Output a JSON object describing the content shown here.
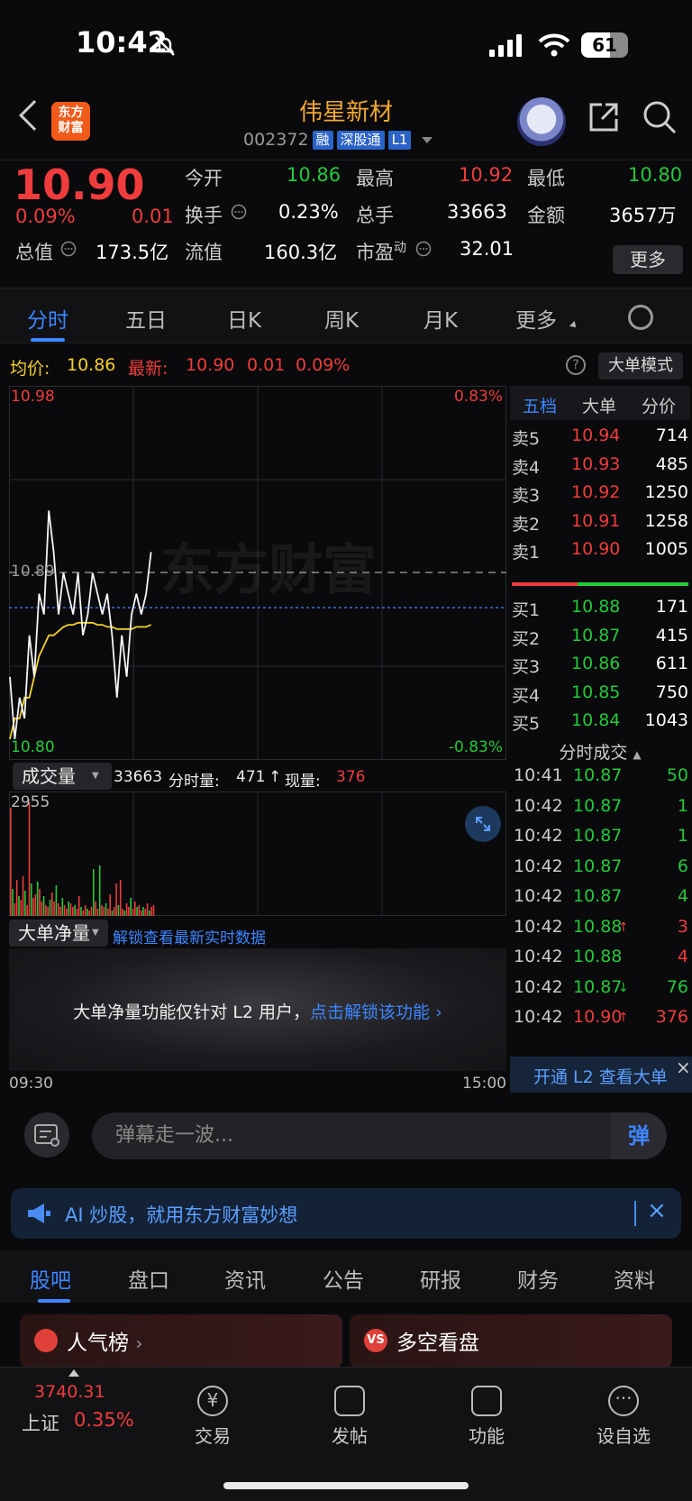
{
  "status_bar": {
    "time": "10:42",
    "battery": "61"
  },
  "header": {
    "logo_line1": "东方",
    "logo_line2": "财富",
    "stock_name": "伟星新材",
    "stock_code": "002372",
    "tags": [
      "融",
      "深股通",
      "L1"
    ]
  },
  "quote": {
    "price": "10.90",
    "change_pct": "0.09%",
    "change": "0.01",
    "open_label": "今开",
    "open": "10.86",
    "high_label": "最高",
    "high": "10.92",
    "low_label": "最低",
    "low": "10.80",
    "turnover_label": "换手",
    "turnover": "0.23%",
    "volume_label": "总手",
    "volume": "33663",
    "amount_label": "金额",
    "amount": "3657万",
    "mktcap_label": "总值",
    "mktcap": "173.5亿",
    "float_label": "流值",
    "float": "160.3亿",
    "pe_label": "市盈",
    "pe_sup": "动",
    "pe": "32.01",
    "more_button": "更多"
  },
  "tabs": [
    "分时",
    "五日",
    "日K",
    "周K",
    "月K",
    "更多"
  ],
  "infoline": {
    "avg_label": "均价:",
    "avg": "10.86",
    "latest_label": "最新:",
    "latest": "10.90",
    "latest_change": "0.01",
    "latest_pct": "0.09%",
    "help": "?",
    "mode_button": "大单模式"
  },
  "chart_labels": {
    "top_price": "10.98",
    "top_pct": "0.83%",
    "mid_price": "10.89",
    "bottom_price": "10.80",
    "bottom_pct": "-0.83%",
    "watermark": "东方财富"
  },
  "chart_data": {
    "type": "line",
    "ylim": [
      10.8,
      10.98
    ],
    "reference": 10.89,
    "series": [
      {
        "values": [
          10.84,
          10.81,
          10.83,
          10.82,
          10.86,
          10.84,
          10.88,
          10.87,
          10.92,
          10.9,
          10.87,
          10.89,
          10.88,
          10.87,
          10.89,
          10.86,
          10.87,
          10.89,
          10.88,
          10.87,
          10.88,
          10.86,
          10.83,
          10.86,
          10.84,
          10.87,
          10.88,
          10.87,
          10.88,
          10.9
        ]
      },
      {
        "values": [
          10.81,
          10.82,
          10.82,
          10.83,
          10.83,
          10.84,
          10.85,
          10.855,
          10.86,
          10.86,
          10.862,
          10.864,
          10.865,
          10.865,
          10.866,
          10.866,
          10.866,
          10.866,
          10.865,
          10.865,
          10.864,
          10.864,
          10.863,
          10.863,
          10.863,
          10.863,
          10.864,
          10.864,
          10.864,
          10.865
        ]
      }
    ]
  },
  "orderbook": {
    "tabs": [
      "五档",
      "大单",
      "分价"
    ],
    "asks": [
      {
        "label": "卖5",
        "price": "10.94",
        "vol": "714"
      },
      {
        "label": "卖4",
        "price": "10.93",
        "vol": "485"
      },
      {
        "label": "卖3",
        "price": "10.92",
        "vol": "1250"
      },
      {
        "label": "卖2",
        "price": "10.91",
        "vol": "1258"
      },
      {
        "label": "卖1",
        "price": "10.90",
        "vol": "1005"
      }
    ],
    "bids": [
      {
        "label": "买1",
        "price": "10.88",
        "vol": "171"
      },
      {
        "label": "买2",
        "price": "10.87",
        "vol": "415"
      },
      {
        "label": "买3",
        "price": "10.86",
        "vol": "611"
      },
      {
        "label": "买4",
        "price": "10.85",
        "vol": "750"
      },
      {
        "label": "买5",
        "price": "10.84",
        "vol": "1043"
      }
    ],
    "ticks_title": "分时成交",
    "ticks": [
      {
        "time": "10:41",
        "price": "10.87",
        "vol": "50",
        "dir": "",
        "pc": "green",
        "vc": "green"
      },
      {
        "time": "10:42",
        "price": "10.87",
        "vol": "1",
        "dir": "",
        "pc": "green",
        "vc": "green"
      },
      {
        "time": "10:42",
        "price": "10.87",
        "vol": "1",
        "dir": "",
        "pc": "green",
        "vc": "green"
      },
      {
        "time": "10:42",
        "price": "10.87",
        "vol": "6",
        "dir": "",
        "pc": "green",
        "vc": "green"
      },
      {
        "time": "10:42",
        "price": "10.87",
        "vol": "4",
        "dir": "",
        "pc": "green",
        "vc": "green"
      },
      {
        "time": "10:42",
        "price": "10.88",
        "vol": "3",
        "dir": "↑",
        "pc": "green",
        "vc": "red"
      },
      {
        "time": "10:42",
        "price": "10.88",
        "vol": "4",
        "dir": "",
        "pc": "green",
        "vc": "red"
      },
      {
        "time": "10:42",
        "price": "10.87",
        "vol": "76",
        "dir": "↓",
        "pc": "green",
        "vc": "green"
      },
      {
        "time": "10:42",
        "price": "10.90",
        "vol": "376",
        "dir": "↑",
        "pc": "red",
        "vc": "red"
      }
    ]
  },
  "volume": {
    "selector": "成交量",
    "total": "33663",
    "period_label": "分时量:",
    "period": "471",
    "arrow": "↑",
    "now_label": "现量:",
    "now": "376",
    "max": "2955"
  },
  "bigorder": {
    "selector": "大单净量",
    "unlock_link": "解锁查看最新实时数据",
    "panel_text": "大单净量功能仅针对 L2 用户，",
    "panel_link": "点击解锁该功能",
    "time_start": "09:30",
    "time_end": "15:00"
  },
  "l2_bar": {
    "text": "开通 L2 查看大单"
  },
  "danmu": {
    "placeholder": "弹幕走一波...",
    "send": "弹"
  },
  "ai_bar": {
    "text": "AI 炒股，就用东方财富妙想"
  },
  "bottom_tabs": [
    "股吧",
    "盘口",
    "资讯",
    "公告",
    "研报",
    "财务",
    "资料"
  ],
  "cards": [
    {
      "icon": "",
      "title": "人气榜"
    },
    {
      "icon": "VS",
      "title": "多空看盘"
    }
  ],
  "tabbar": {
    "index_value": "3740.31",
    "index_name": "上证",
    "index_pct": "0.35%",
    "items": [
      "交易",
      "发帖",
      "功能",
      "设自选"
    ]
  },
  "colors": {
    "up": "#f03c3c",
    "down": "#23c93a",
    "accent": "#3c86ff",
    "avg_line": "#f2d02b"
  }
}
